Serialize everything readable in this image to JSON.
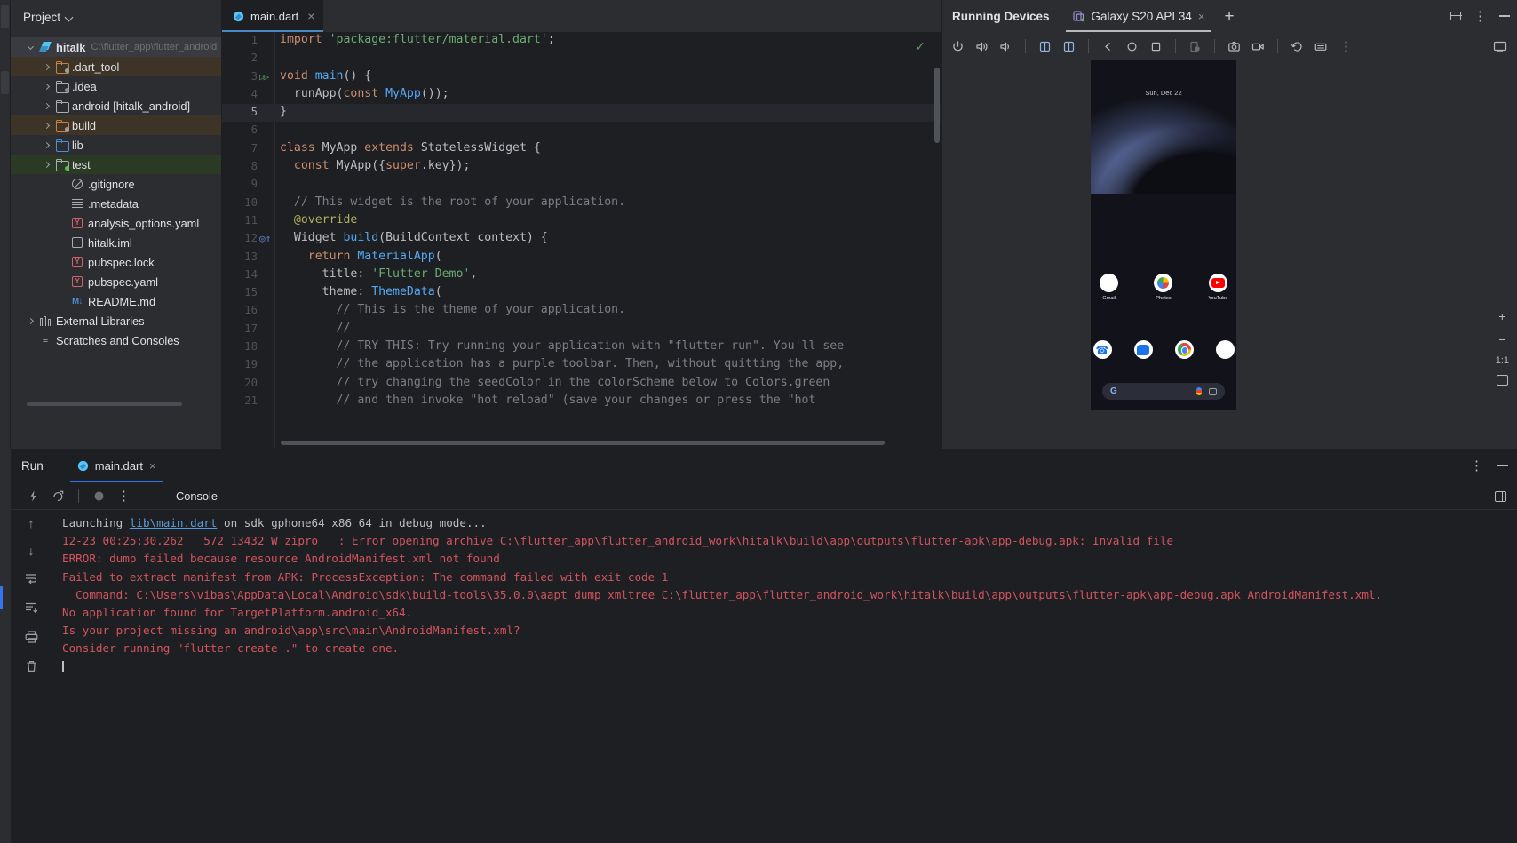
{
  "window": {
    "theme_bg": "#1e1f22",
    "panel_bg": "#2b2d30",
    "accent": "#3574f0",
    "error_color": "#d1545e",
    "link_color": "#5a9bd8"
  },
  "project_panel": {
    "title": "Project",
    "dropdown_icon": "chevron-down-icon",
    "tree": [
      {
        "label": "hitalk",
        "path": "C:\\flutter_app\\flutter_android",
        "icon": "flutter-icon",
        "depth": 0,
        "arrow": "expanded",
        "bold": true,
        "highlight": "selected"
      },
      {
        "label": ".dart_tool",
        "icon": "folder-orange-icon",
        "depth": 1,
        "arrow": "collapsed",
        "highlight": "excluded"
      },
      {
        "label": ".idea",
        "icon": "folder-excluded-icon",
        "depth": 1,
        "arrow": "collapsed",
        "highlight": "none"
      },
      {
        "label": "android [hitalk_android]",
        "icon": "folder-icon",
        "depth": 1,
        "arrow": "collapsed",
        "highlight": "none"
      },
      {
        "label": "build",
        "icon": "folder-orange-icon",
        "depth": 1,
        "arrow": "collapsed",
        "highlight": "excluded"
      },
      {
        "label": "lib",
        "icon": "folder-blue-icon",
        "depth": 1,
        "arrow": "collapsed",
        "highlight": "none"
      },
      {
        "label": "test",
        "icon": "folder-test-icon",
        "depth": 1,
        "arrow": "collapsed",
        "highlight": "test"
      },
      {
        "label": ".gitignore",
        "icon": "gitignore-icon",
        "depth": 2,
        "arrow": "none",
        "highlight": "none"
      },
      {
        "label": ".metadata",
        "icon": "text-file-icon",
        "depth": 2,
        "arrow": "none",
        "highlight": "none"
      },
      {
        "label": "analysis_options.yaml",
        "icon": "yaml-icon",
        "depth": 2,
        "arrow": "none",
        "highlight": "none"
      },
      {
        "label": "hitalk.iml",
        "icon": "iml-icon",
        "depth": 2,
        "arrow": "none",
        "highlight": "none"
      },
      {
        "label": "pubspec.lock",
        "icon": "yaml-icon",
        "depth": 2,
        "arrow": "none",
        "highlight": "none"
      },
      {
        "label": "pubspec.yaml",
        "icon": "yaml-icon",
        "depth": 2,
        "arrow": "none",
        "highlight": "none"
      },
      {
        "label": "README.md",
        "icon": "markdown-icon",
        "depth": 2,
        "arrow": "none",
        "highlight": "none"
      },
      {
        "label": "External Libraries",
        "icon": "library-icon",
        "depth": 0,
        "arrow": "collapsed",
        "highlight": "none"
      },
      {
        "label": "Scratches and Consoles",
        "icon": "scratches-icon",
        "depth": 0,
        "arrow": "none",
        "highlight": "none"
      }
    ]
  },
  "editor": {
    "tab": {
      "label": "main.dart",
      "icon": "dart-file-icon",
      "close_label": "×"
    },
    "status_icon": "inspection-ok-icon",
    "lines": [
      {
        "n": 1,
        "gutter": "",
        "tokens": [
          {
            "t": "import ",
            "c": "kw"
          },
          {
            "t": "'package:flutter/material.dart'",
            "c": "str"
          },
          {
            "t": ";",
            "c": "typ"
          }
        ]
      },
      {
        "n": 2,
        "gutter": "",
        "tokens": []
      },
      {
        "n": 3,
        "gutter": "run",
        "tokens": [
          {
            "t": "void ",
            "c": "kw"
          },
          {
            "t": "main",
            "c": "fn"
          },
          {
            "t": "() {",
            "c": "typ"
          }
        ]
      },
      {
        "n": 4,
        "gutter": "",
        "tokens": [
          {
            "t": "  runApp(",
            "c": "typ"
          },
          {
            "t": "const ",
            "c": "kw"
          },
          {
            "t": "MyApp",
            "c": "fn"
          },
          {
            "t": "());",
            "c": "typ"
          }
        ]
      },
      {
        "n": 5,
        "gutter": "",
        "current": true,
        "tokens": [
          {
            "t": "}",
            "c": "typ"
          }
        ]
      },
      {
        "n": 6,
        "gutter": "",
        "tokens": []
      },
      {
        "n": 7,
        "gutter": "",
        "tokens": [
          {
            "t": "class ",
            "c": "kw"
          },
          {
            "t": "MyApp ",
            "c": "typ"
          },
          {
            "t": "extends ",
            "c": "kw"
          },
          {
            "t": "StatelessWidget {",
            "c": "typ"
          }
        ]
      },
      {
        "n": 8,
        "gutter": "",
        "tokens": [
          {
            "t": "  ",
            "c": "typ"
          },
          {
            "t": "const ",
            "c": "kw"
          },
          {
            "t": "MyApp({",
            "c": "typ"
          },
          {
            "t": "super",
            "c": "kw"
          },
          {
            "t": ".key});",
            "c": "typ"
          }
        ]
      },
      {
        "n": 9,
        "gutter": "",
        "tokens": []
      },
      {
        "n": 10,
        "gutter": "",
        "tokens": [
          {
            "t": "  // This widget is the root of your application.",
            "c": "cmt"
          }
        ]
      },
      {
        "n": 11,
        "gutter": "",
        "tokens": [
          {
            "t": "  @override",
            "c": "anno"
          }
        ]
      },
      {
        "n": 12,
        "gutter": "override",
        "tokens": [
          {
            "t": "  Widget ",
            "c": "typ"
          },
          {
            "t": "build",
            "c": "fn"
          },
          {
            "t": "(BuildContext context) {",
            "c": "typ"
          }
        ]
      },
      {
        "n": 13,
        "gutter": "",
        "tokens": [
          {
            "t": "    return ",
            "c": "kw"
          },
          {
            "t": "MaterialApp",
            "c": "fn"
          },
          {
            "t": "(",
            "c": "typ"
          }
        ]
      },
      {
        "n": 14,
        "gutter": "",
        "tokens": [
          {
            "t": "      title: ",
            "c": "typ"
          },
          {
            "t": "'Flutter Demo'",
            "c": "str"
          },
          {
            "t": ",",
            "c": "typ"
          }
        ]
      },
      {
        "n": 15,
        "gutter": "",
        "tokens": [
          {
            "t": "      theme: ",
            "c": "typ"
          },
          {
            "t": "ThemeData",
            "c": "fn"
          },
          {
            "t": "(",
            "c": "typ"
          }
        ]
      },
      {
        "n": 16,
        "gutter": "",
        "tokens": [
          {
            "t": "        // This is the theme of your application.",
            "c": "cmt"
          }
        ]
      },
      {
        "n": 17,
        "gutter": "",
        "tokens": [
          {
            "t": "        //",
            "c": "cmt"
          }
        ]
      },
      {
        "n": 18,
        "gutter": "",
        "tokens": [
          {
            "t": "        // TRY THIS: Try running your application with \"flutter run\". You'll see",
            "c": "cmt"
          }
        ]
      },
      {
        "n": 19,
        "gutter": "",
        "tokens": [
          {
            "t": "        // the application has a purple toolbar. Then, without quitting the app,",
            "c": "cmt"
          }
        ]
      },
      {
        "n": 20,
        "gutter": "",
        "tokens": [
          {
            "t": "        // try changing the seedColor in the colorScheme below to Colors.green",
            "c": "cmt"
          }
        ]
      },
      {
        "n": 21,
        "gutter": "",
        "tokens": [
          {
            "t": "        // and then invoke \"hot reload\" (save your changes or press the \"hot",
            "c": "cmt"
          }
        ]
      }
    ]
  },
  "devices": {
    "title": "Running Devices",
    "tab": {
      "label": "Galaxy S20 API 34",
      "icon": "device-icon",
      "close_label": "×"
    },
    "add_label": "+",
    "window_buttons": [
      "restore-window-icon",
      "options-kebab-icon",
      "minimize-icon"
    ],
    "toolbar": [
      "power-icon",
      "volume-up-icon",
      "volume-down-icon",
      "rotate-left-icon",
      "rotate-right-icon",
      "back-icon",
      "home-icon",
      "overview-icon",
      "device-settings-icon",
      "screenshot-icon",
      "record-icon",
      "history-icon",
      "keyboard-icon",
      "more-kebab-icon"
    ],
    "toolbar_right": [
      "device-mirroring-icon"
    ],
    "emulator": {
      "date_text": "Sun, Dec 22",
      "apps_row1": [
        {
          "label": "Gmail",
          "icon": "gmail-icon"
        },
        {
          "label": "Photos",
          "icon": "google-photos-icon"
        },
        {
          "label": "YouTube",
          "icon": "youtube-icon"
        }
      ],
      "apps_row2": [
        {
          "label": "",
          "icon": "phone-icon"
        },
        {
          "label": "",
          "icon": "messages-icon"
        },
        {
          "label": "",
          "icon": "chrome-icon"
        },
        {
          "label": "",
          "icon": "gmail-icon"
        }
      ],
      "search": {
        "g_label": "G",
        "mic": "microphone-icon",
        "lens": "google-lens-icon"
      }
    },
    "side_tools": [
      "zoom-in-icon",
      "zoom-out-icon",
      "zoom-actual-size",
      "fit-to-screen-icon"
    ],
    "zoom_level": "1:1"
  },
  "run_panel": {
    "label": "Run",
    "tab": {
      "label": "main.dart",
      "icon": "dart-file-icon",
      "close_label": "×"
    },
    "toolbar": [
      "rerun-icon",
      "restart-icon",
      "stop-icon",
      "more-kebab-icon"
    ],
    "console_label": "Console",
    "toolbar_right": [
      "split-window-icon"
    ],
    "window_buttons": [
      "options-kebab-icon",
      "minimize-icon"
    ],
    "side_tools": [
      "scroll-up-icon",
      "scroll-down-icon",
      "soft-wrap-icon",
      "scroll-to-end-icon",
      "print-icon",
      "clear-all-icon"
    ],
    "console_lines": [
      {
        "type": "info",
        "segments": [
          {
            "t": "Launching "
          },
          {
            "t": "lib\\main.dart",
            "link": true
          },
          {
            "t": " on sdk gphone64 x86 64 in debug mode..."
          }
        ]
      },
      {
        "type": "error",
        "segments": [
          {
            "t": "12-23 00:25:30.262   572 13432 W zipro   : Error opening archive C:\\flutter_app\\flutter_android_work\\hitalk\\build\\app\\outputs\\flutter-apk\\app-debug.apk: Invalid file"
          }
        ]
      },
      {
        "type": "error",
        "segments": [
          {
            "t": "ERROR: dump failed because resource AndroidManifest.xml not found"
          }
        ]
      },
      {
        "type": "error",
        "segments": [
          {
            "t": "Failed to extract manifest from APK: ProcessException: The command failed with exit code 1"
          }
        ]
      },
      {
        "type": "error",
        "segments": [
          {
            "t": "  Command: C:\\Users\\vibas\\AppData\\Local\\Android\\sdk\\build-tools\\35.0.0\\aapt dump xmltree C:\\flutter_app\\flutter_android_work\\hitalk\\build\\app\\outputs\\flutter-apk\\app-debug.apk AndroidManifest.xml."
          }
        ]
      },
      {
        "type": "error",
        "segments": [
          {
            "t": "No application found for TargetPlatform.android_x64."
          }
        ]
      },
      {
        "type": "error",
        "segments": [
          {
            "t": "Is your project missing an android\\app\\src\\main\\AndroidManifest.xml?"
          }
        ]
      },
      {
        "type": "error",
        "segments": [
          {
            "t": "Consider running \"flutter create .\" to create one."
          }
        ]
      },
      {
        "type": "caret",
        "segments": []
      }
    ]
  }
}
